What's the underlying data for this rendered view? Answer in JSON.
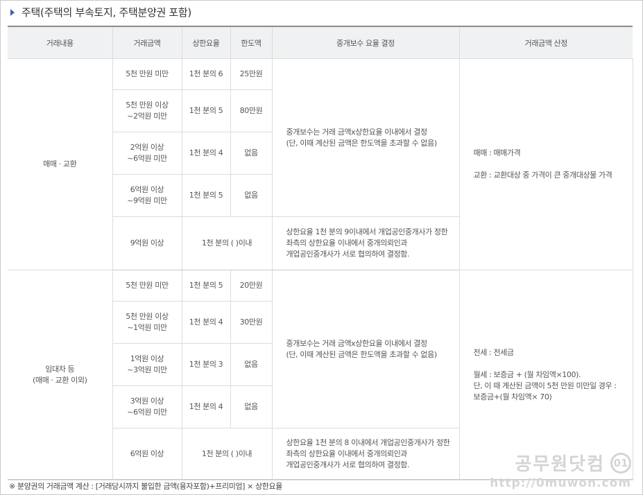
{
  "title": "주택(주택의 부속토지, 주택분양권 포함)",
  "headers": {
    "content": "거래내용",
    "amount": "거래금액",
    "rate": "상한요율",
    "limit": "한도액",
    "decision": "중개보수 요율 결정",
    "calc": "거래금액 산정"
  },
  "sale": {
    "label": "매매 · 교환",
    "rows": [
      {
        "amount": "5천 만원 미만",
        "rate": "1천 분의 6",
        "limit": "25만원"
      },
      {
        "amount": "5천 만원 이상\n~2억원 미만",
        "rate": "1천 분의 5",
        "limit": "80만원"
      },
      {
        "amount": "2억원 이상\n~6억원 미만",
        "rate": "1천 분의 4",
        "limit": "없음"
      },
      {
        "amount": "6억원 이상\n~9억원 미만",
        "rate": "1천 분의 5",
        "limit": "없음"
      },
      {
        "amount": "9억원 이상",
        "rate_limit": "1천 분의 (   )이내"
      }
    ],
    "decision_main": "중개보수는 거래 금액x상한요율 이내에서 결정\n(단, 이때 계산된 금액은 한도액을 초과할 수 없음)",
    "decision_last": "상한요율 1천 분의 9이내에서 개업공인중개사가 정한\n좌측의 상한요율 이내에서 중개의뢰인과\n개업공인중개사가 서로 협의하여 결정함.",
    "calc": "매매 : 매매가격\n\n교환 : 교환대상 중 가격이 큰 중개대상물 가격"
  },
  "lease": {
    "label": "임대차 등\n(매매 · 교환 이외)",
    "rows": [
      {
        "amount": "5천 만원 미만",
        "rate": "1천 분의 5",
        "limit": "20만원"
      },
      {
        "amount": "5천 만원 이상\n~1억원 미만",
        "rate": "1천 분의 4",
        "limit": "30만원"
      },
      {
        "amount": "1억원 이상\n~3억원 미만",
        "rate": "1천 분의 3",
        "limit": "없음"
      },
      {
        "amount": "3억원 이상\n~6억원 미만",
        "rate": "1천 분의 4",
        "limit": "없음"
      },
      {
        "amount": "6억원 이상",
        "rate_limit": "1천 분의 (   )이내"
      }
    ],
    "decision_main": "중개보수는 거래 금액x상한요율 이내에서 결정\n(단, 이때 계산된 금액은 한도액을 초과할 수 없음)",
    "decision_last": "상한요율 1천 분의 8 이내에서 개업공인중개사가 정한\n좌측의 상한요율 이내에서 중개의뢰인과\n개업공인중개사가 서로 협의하여 결정함.",
    "calc": "전세 : 전세금\n\n월세 : 보증금 + (월 차임액×100).\n단, 이 때 계산된 금액이 5천 만원 미만일 경우 :\n보증금+(월 차임액× 70)"
  },
  "footnote": "※ 분양권의 거래금액 계산 : [거래당시까지 불입한 금액(융자포함)+프리미엄] × 상한요율",
  "watermark": {
    "name": "공무원닷컴",
    "logo": "01",
    "url": "http://0muwon.com"
  }
}
